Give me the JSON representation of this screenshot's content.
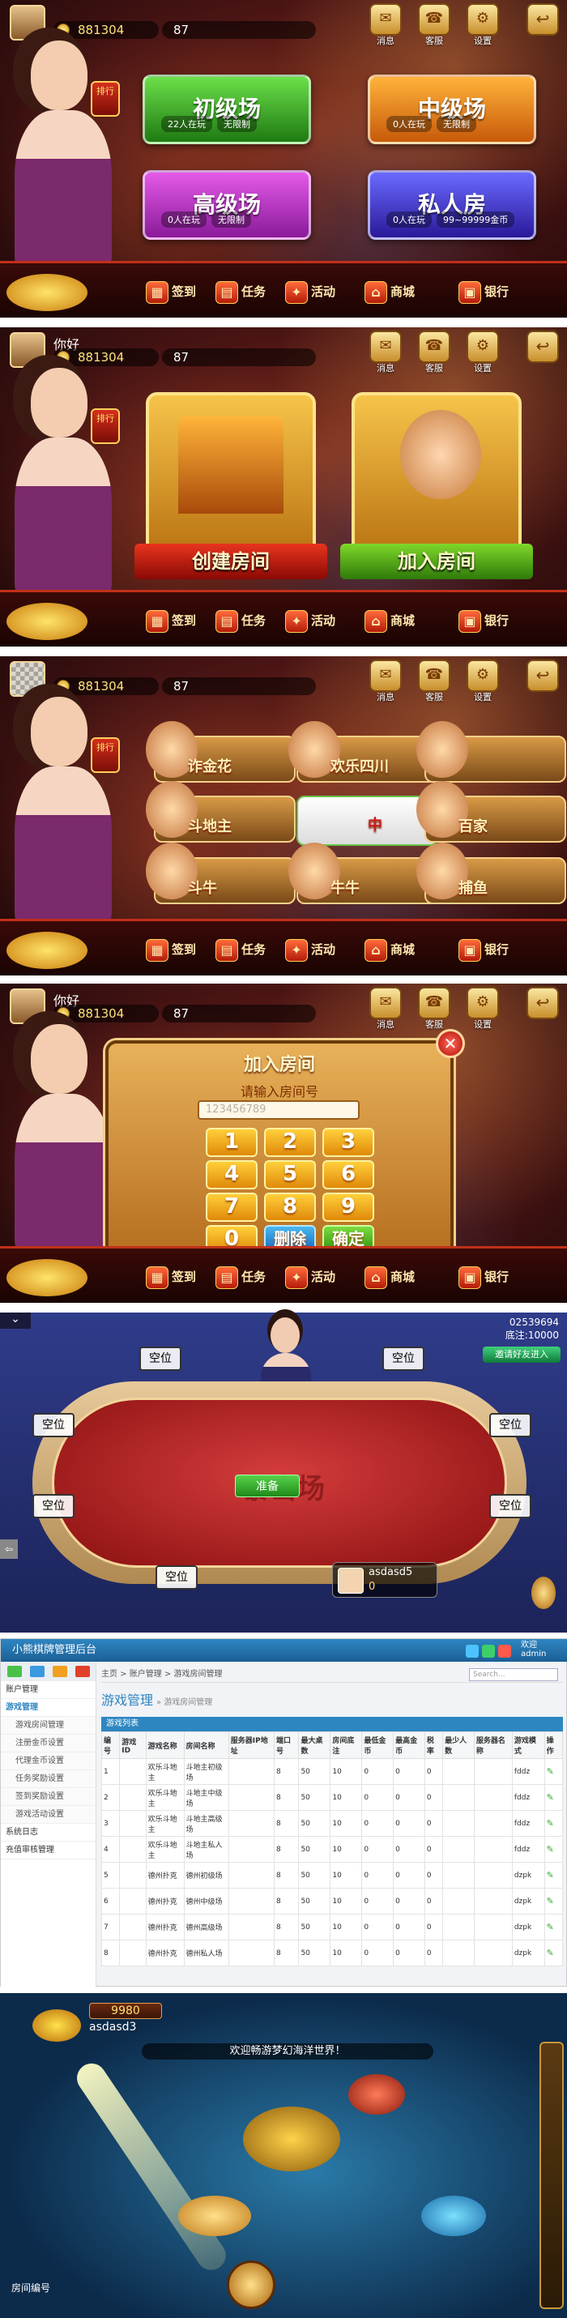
{
  "lobby1": {
    "username": "",
    "gold": "881304",
    "gems": "87",
    "rank_label": "排行",
    "top_buttons": [
      "消息",
      "客服",
      "设置"
    ],
    "cards": [
      {
        "title": "初级场",
        "online": "22人在玩",
        "limit": "无限制",
        "color": "#3aa52a"
      },
      {
        "title": "中级场",
        "online": "0人在玩",
        "limit": "无限制",
        "color": "#e07a10"
      },
      {
        "title": "高级场",
        "online": "0人在玩",
        "limit": "无限制",
        "color": "#b02ab8"
      },
      {
        "title": "私人房",
        "online": "0人在玩",
        "limit": "99~99999金币",
        "color": "#3a3ac8"
      }
    ],
    "bottom": [
      "签到",
      "任务",
      "活动",
      "商城",
      "银行"
    ]
  },
  "lobby2": {
    "username": "你好",
    "gold": "881304",
    "gems": "87",
    "rank_label": "排行",
    "top_buttons": [
      "消息",
      "客服",
      "设置"
    ],
    "create_room": "创建房间",
    "join_room": "加入房间",
    "bottom": [
      "签到",
      "任务",
      "活动",
      "商城",
      "银行"
    ]
  },
  "lobby3": {
    "username": "",
    "gold": "881304",
    "gems": "87",
    "rank_label": "排行",
    "top_buttons": [
      "消息",
      "客服",
      "设置"
    ],
    "games": [
      "诈金花",
      "欢乐四川",
      "",
      "斗地主",
      "中",
      "百家",
      "斗牛",
      "牛牛",
      "捕鱼"
    ],
    "bottom": [
      "签到",
      "任务",
      "活动",
      "商城",
      "银行"
    ]
  },
  "lobby4": {
    "username": "你好",
    "gold": "881304",
    "gems": "87",
    "top_buttons": [
      "消息",
      "客服",
      "设置"
    ],
    "modal": {
      "title": "加入房间",
      "prompt": "请输入房间号",
      "placeholder": "123456789",
      "keys": [
        "1",
        "2",
        "3",
        "4",
        "5",
        "6",
        "7",
        "8",
        "9",
        "0",
        "删除",
        "确定"
      ]
    },
    "bottom": [
      "签到",
      "任务",
      "活动",
      "商城",
      "银行"
    ]
  },
  "poker": {
    "seat_label": "空位",
    "ready_label": "准备",
    "table_logo": "暴击场",
    "player_name": "asdasd5",
    "player_coins": "0",
    "room_id": "02539694",
    "base_score": "底注:10000",
    "green_btn": "邀请好友进入"
  },
  "admin": {
    "app_title": "小熊棋牌管理后台",
    "user": "admin",
    "breadcrumb": "主页 > 账户管理 > 游戏房间管理",
    "search_placeholder": "Search...",
    "page_title": "游戏管理",
    "page_subtitle": "» 游戏房间管理",
    "table_caption": "游戏列表",
    "sidebar": [
      {
        "label": "账户管理",
        "sub": false,
        "active": false
      },
      {
        "label": "游戏管理",
        "sub": false,
        "active": true
      },
      {
        "label": "游戏房间管理",
        "sub": true,
        "active": false
      },
      {
        "label": "注册金币设置",
        "sub": true,
        "active": false
      },
      {
        "label": "代理金币设置",
        "sub": true,
        "active": false
      },
      {
        "label": "任务奖励设置",
        "sub": true,
        "active": false
      },
      {
        "label": "签到奖励设置",
        "sub": true,
        "active": false
      },
      {
        "label": "游戏活动设置",
        "sub": true,
        "active": false
      },
      {
        "label": "系统日志",
        "sub": false,
        "active": false
      },
      {
        "label": "充值审核管理",
        "sub": false,
        "active": false
      }
    ],
    "columns": [
      "编号",
      "游戏ID",
      "游戏名称",
      "房间名称",
      "服务器IP地址",
      "端口号",
      "最大桌数",
      "房间底注",
      "最低金币",
      "最高金币",
      "税率",
      "最少人数",
      "服务器名称",
      "游戏模式",
      "操作"
    ],
    "rows": [
      [
        "1",
        "",
        "欢乐斗地主",
        "斗地主初级场",
        "",
        "8",
        "50",
        "10",
        "0",
        "0",
        "0",
        "",
        "",
        "fddz",
        "✎"
      ],
      [
        "2",
        "",
        "欢乐斗地主",
        "斗地主中级场",
        "",
        "8",
        "50",
        "10",
        "0",
        "0",
        "0",
        "",
        "",
        "fddz",
        "✎"
      ],
      [
        "3",
        "",
        "欢乐斗地主",
        "斗地主高级场",
        "",
        "8",
        "50",
        "10",
        "0",
        "0",
        "0",
        "",
        "",
        "fddz",
        "✎"
      ],
      [
        "4",
        "",
        "欢乐斗地主",
        "斗地主私人场",
        "",
        "8",
        "50",
        "10",
        "0",
        "0",
        "0",
        "",
        "",
        "fddz",
        "✎"
      ],
      [
        "5",
        "",
        "德州扑克",
        "德州初级场",
        "",
        "8",
        "50",
        "10",
        "0",
        "0",
        "0",
        "",
        "",
        "dzpk",
        "✎"
      ],
      [
        "6",
        "",
        "德州扑克",
        "德州中级场",
        "",
        "8",
        "50",
        "10",
        "0",
        "0",
        "0",
        "",
        "",
        "dzpk",
        "✎"
      ],
      [
        "7",
        "",
        "德州扑克",
        "德州高级场",
        "",
        "8",
        "50",
        "10",
        "0",
        "0",
        "0",
        "",
        "",
        "dzpk",
        "✎"
      ],
      [
        "8",
        "",
        "德州扑克",
        "德州私人场",
        "",
        "8",
        "50",
        "10",
        "0",
        "0",
        "0",
        "",
        "",
        "dzpk",
        "✎"
      ]
    ]
  },
  "fish": {
    "score": "9980",
    "name": "asdasd3",
    "notice": "欢迎畅游梦幻海洋世界！",
    "bottom_label": "房间编号"
  }
}
